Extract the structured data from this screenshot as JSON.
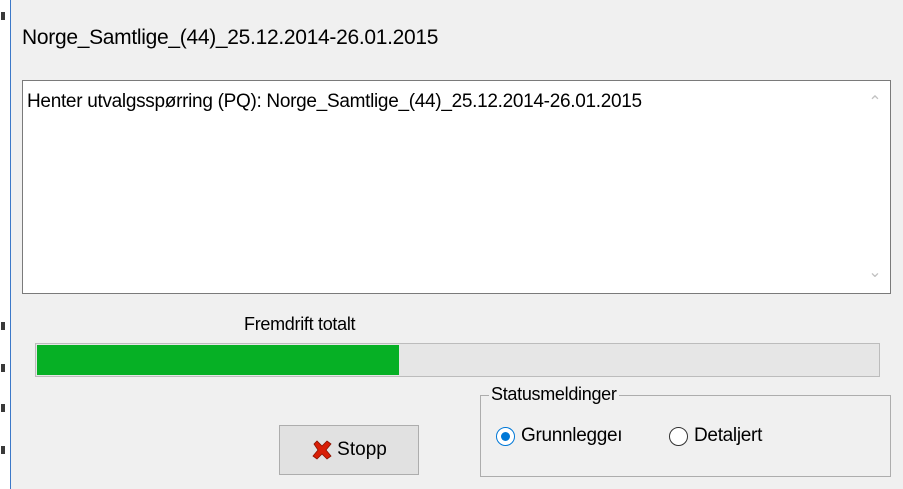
{
  "window": {
    "title": "Norge_Samtlige_(44)_25.12.2014-26.01.2015"
  },
  "log": {
    "lines": [
      "Henter utvalgsspørring (PQ): Norge_Samtlige_(44)_25.12.2014-26.01.2015"
    ],
    "scroll_up_icon": "chevron-up-icon",
    "scroll_down_icon": "chevron-down-icon"
  },
  "progress": {
    "label": "Fremdrift totalt",
    "value_fraction": 0.43,
    "color": "#06b025"
  },
  "stop_button": {
    "label": "Stopp",
    "icon": "red-x-icon",
    "icon_color": "#d81e06"
  },
  "status_messages": {
    "title": "Statusmeldinger",
    "options": [
      {
        "label": "Grunnlegger",
        "visible_text": "Grunnleggeı",
        "selected": true
      },
      {
        "label": "Detaljert",
        "visible_text": "Detaljert",
        "selected": false
      }
    ],
    "accent_color": "#0078d7"
  }
}
